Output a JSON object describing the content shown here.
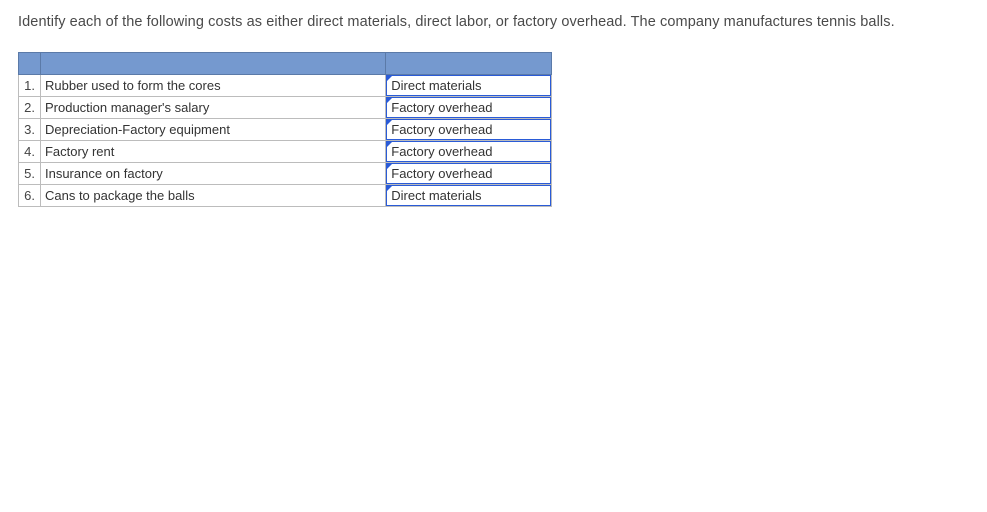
{
  "instruction": "Identify each of the following costs as either direct materials, direct labor, or factory overhead. The company manufactures tennis balls.",
  "rows": [
    {
      "num": "1.",
      "desc": "Rubber used to form the cores",
      "answer": "Direct materials"
    },
    {
      "num": "2.",
      "desc": "Production manager's salary",
      "answer": "Factory overhead"
    },
    {
      "num": "3.",
      "desc": "Depreciation-Factory equipment",
      "answer": "Factory overhead"
    },
    {
      "num": "4.",
      "desc": "Factory rent",
      "answer": "Factory overhead"
    },
    {
      "num": "5.",
      "desc": "Insurance on factory",
      "answer": "Factory overhead"
    },
    {
      "num": "6.",
      "desc": "Cans to package the balls",
      "answer": "Direct materials"
    }
  ]
}
